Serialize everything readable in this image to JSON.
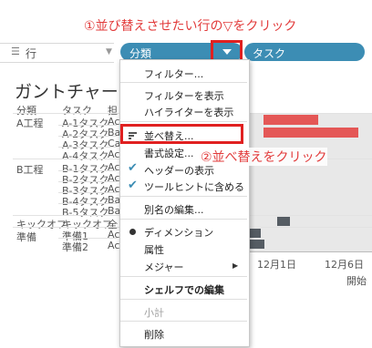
{
  "annotations": {
    "step1": "①並び替えさせたい行の▽をクリック",
    "step2": "②並べ替えをクリック"
  },
  "shelf": {
    "rows_label": "行",
    "pill_bunrui": "分類",
    "pill_task": "タスク"
  },
  "worksheet": {
    "title": "ガントチャート",
    "headers": [
      "分類",
      "タスク",
      "担"
    ],
    "groups": [
      {
        "label": "A工程",
        "tasks": [
          "A-1タスク",
          "A-2タスク",
          "A-3タスク",
          "A-4タスク"
        ],
        "owner": [
          "Ac",
          "Ba",
          "Ca",
          "Ac"
        ]
      },
      {
        "label": "B工程",
        "tasks": [
          "B-1タスク",
          "B-2タスク",
          "B-3タスク",
          "B-4タスク",
          "B-5タスク"
        ],
        "owner": [
          "Ac",
          "Ac",
          "Ac",
          "Ba",
          "Ba"
        ]
      },
      {
        "label": "キックオフ",
        "tasks": [
          "キックオフ"
        ],
        "owner": [
          "全"
        ]
      },
      {
        "label": "準備",
        "tasks": [
          "準備1",
          "準備2"
        ],
        "owner": [
          "Ac",
          "Ac"
        ]
      }
    ],
    "axis": {
      "tick1": "12月1日",
      "tick2": "12月6日",
      "title_partial": "開始"
    }
  },
  "menu": {
    "filter": "フィルター...",
    "show_filter": "フィルターを表示",
    "show_highlighter": "ハイライターを表示",
    "sort": "並べ替え...",
    "format": "書式設定...",
    "show_header": "ヘッダーの表示",
    "include_tooltip": "ツールヒントに含める",
    "edit_alias": "別名の編集...",
    "dimension": "ディメンション",
    "attribute": "属性",
    "measure": "メジャー",
    "edit_in_shelf": "シェルフでの編集",
    "subtotal": "小計",
    "delete": "削除"
  },
  "colors": {
    "accent": "#3c8db4",
    "annotation": "#e02020",
    "bar_red": "#e45756",
    "bar_gray": "#555c63"
  }
}
